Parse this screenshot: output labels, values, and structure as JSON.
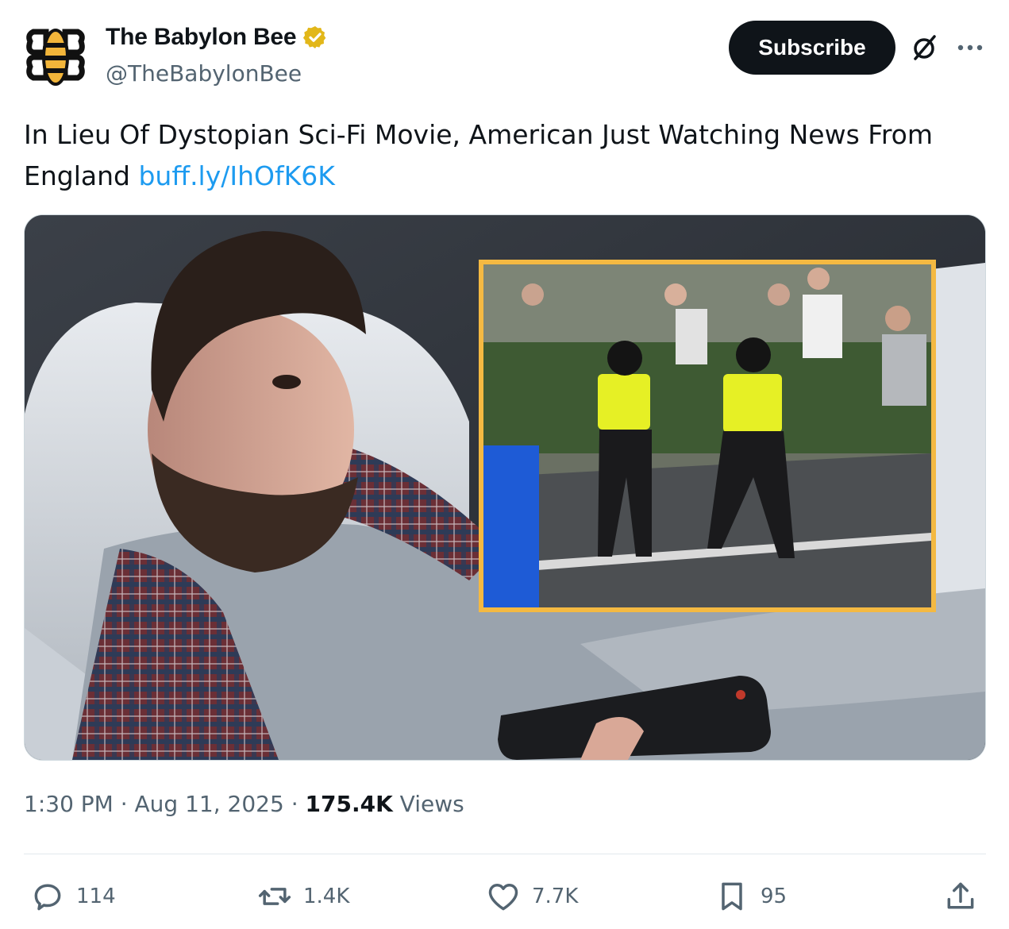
{
  "account": {
    "name": "The Babylon Bee",
    "handle": "@TheBabylonBee",
    "verified_color": "#e2b719",
    "avatar_icon": "bee-logo-icon"
  },
  "header": {
    "subscribe_label": "Subscribe",
    "grok_icon": "grok-icon",
    "more_icon": "more-dots-icon"
  },
  "post": {
    "text": "In Lieu Of Dystopian Sci-Fi Movie, American Just Watching News From England ",
    "link": "buff.ly/IhOfK6K",
    "link_color": "#1d9bf0"
  },
  "media": {
    "frame_color": "#f4b942"
  },
  "meta": {
    "time": "1:30 PM",
    "separator": " · ",
    "date": "Aug 11, 2025",
    "views_count": "175.4K",
    "views_label": " Views"
  },
  "actions": {
    "replies": "114",
    "reposts": "1.4K",
    "likes": "7.7K",
    "bookmarks": "95"
  }
}
